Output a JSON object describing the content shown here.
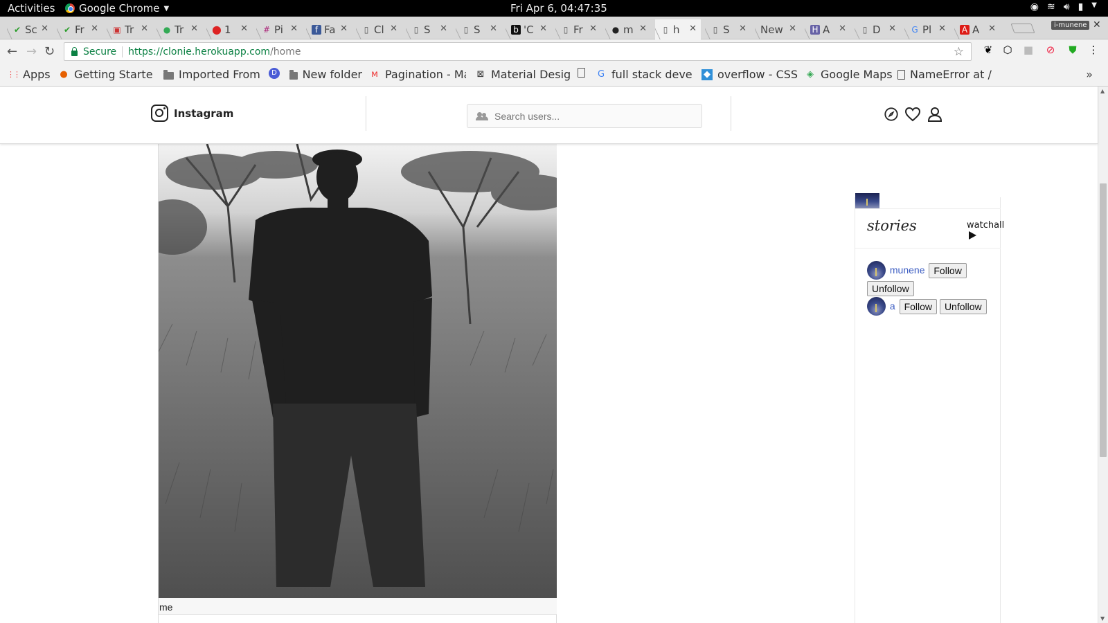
{
  "topbar": {
    "activities": "Activities",
    "app_name": "Google Chrome",
    "clock": "Fri Apr  6, 04:47:35"
  },
  "tabs": [
    {
      "favicon": "check-icon",
      "text": "Sc"
    },
    {
      "favicon": "check-icon",
      "text": "Fr"
    },
    {
      "favicon": "red-square-icon",
      "text": "Tr"
    },
    {
      "favicon": "circle-icon",
      "text": "Tr"
    },
    {
      "favicon": "red-dot-icon",
      "text": "1"
    },
    {
      "favicon": "hash-icon",
      "text": "Pi"
    },
    {
      "favicon": "facebook-icon",
      "text": "Fa"
    },
    {
      "favicon": "doc-icon",
      "text": "Cl"
    },
    {
      "favicon": "doc-icon",
      "text": "S"
    },
    {
      "favicon": "doc-icon",
      "text": "S"
    },
    {
      "favicon": "b-icon",
      "text": "'C"
    },
    {
      "favicon": "doc-icon",
      "text": "Fr"
    },
    {
      "favicon": "github-icon",
      "text": "m"
    },
    {
      "favicon": "doc-icon",
      "text": "h"
    },
    {
      "favicon": "doc-icon",
      "text": "S"
    },
    {
      "favicon": "none",
      "text": "New"
    },
    {
      "favicon": "heroku-icon",
      "text": "A"
    },
    {
      "favicon": "doc-icon",
      "text": "D"
    },
    {
      "favicon": "google-icon",
      "text": "Pl"
    },
    {
      "favicon": "angular-icon",
      "text": "A"
    }
  ],
  "profile_label": "i-munene",
  "address": {
    "secure_label": "Secure",
    "url_host": "https://clonie.herokuapp.com",
    "url_path": "/home"
  },
  "bookmarks": [
    {
      "icon": "apps-grid-icon",
      "label": "Apps"
    },
    {
      "icon": "firefox-icon",
      "label": "Getting Starte"
    },
    {
      "icon": "folder-icon",
      "label": "Imported From"
    },
    {
      "icon": "d-icon",
      "label": ""
    },
    {
      "icon": "folder-icon",
      "label": "New folder"
    },
    {
      "icon": "m-icon",
      "label": "Pagination - Ma"
    },
    {
      "icon": "x-icon",
      "label": "Material Desig"
    },
    {
      "icon": "doc-icon",
      "label": ""
    },
    {
      "icon": "google-icon",
      "label": "full stack deve"
    },
    {
      "icon": "overflow-icon",
      "label": "overflow - CSS"
    },
    {
      "icon": "maps-icon",
      "label": "Google Maps"
    },
    {
      "icon": "doc-icon",
      "label": "NameError at /"
    }
  ],
  "header": {
    "brand": "Instagram",
    "search_placeholder": "Search users..."
  },
  "post": {
    "caption": "me"
  },
  "sidebar": {
    "stories_title": "stories",
    "watchall": "watchall",
    "users": [
      {
        "name": "munene",
        "follow": "Follow",
        "unfollow": "Unfollow"
      },
      {
        "name": "a",
        "follow": "Follow",
        "unfollow": "Unfollow"
      }
    ]
  }
}
